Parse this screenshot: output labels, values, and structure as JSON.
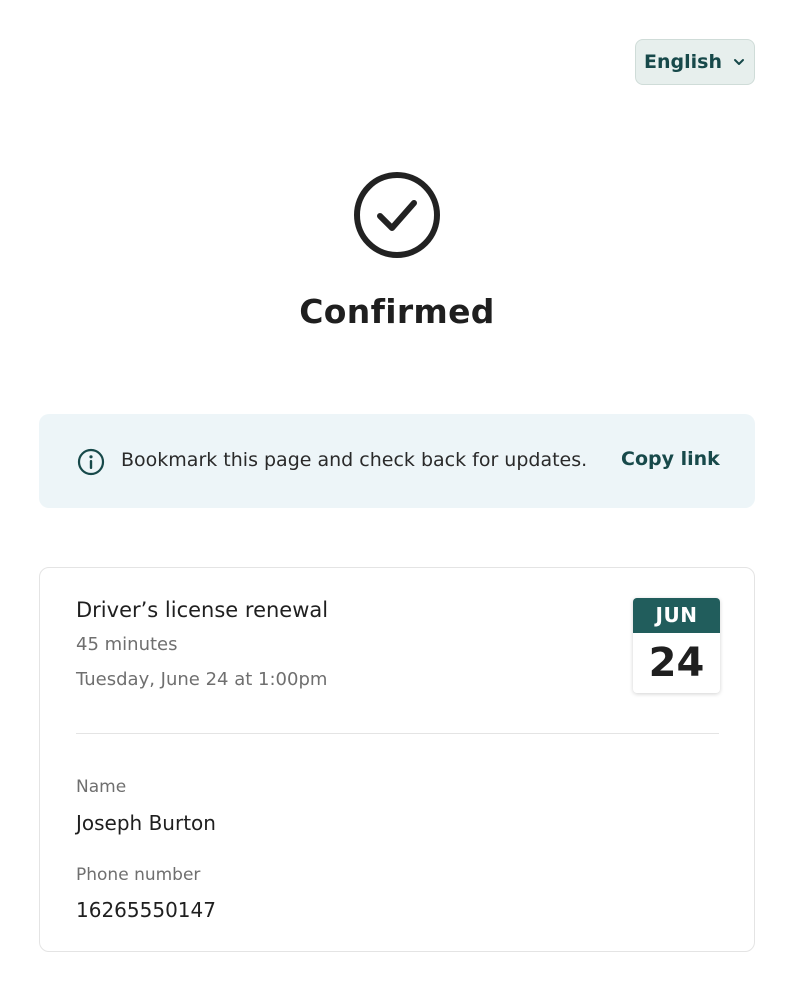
{
  "language_selector": {
    "label": "English",
    "icon": "chevron-down-icon"
  },
  "status": {
    "icon": "check-circle-icon",
    "title": "Confirmed"
  },
  "banner": {
    "icon": "info-icon",
    "message": "Bookmark this page and check back for updates.",
    "action_label": "Copy link"
  },
  "appointment": {
    "service": "Driver’s license renewal",
    "duration": "45 minutes",
    "datetime": "Tuesday, June 24 at 1:00pm",
    "calendar": {
      "month": "JUN",
      "day": "24"
    },
    "fields": {
      "name_label": "Name",
      "name_value": "Joseph Burton",
      "phone_label": "Phone number",
      "phone_value": "16265550147"
    }
  },
  "colors": {
    "accent": "#17494a",
    "calendar_header": "#215d5c",
    "banner_bg": "#edf5f8",
    "selector_bg": "#e7efed"
  }
}
